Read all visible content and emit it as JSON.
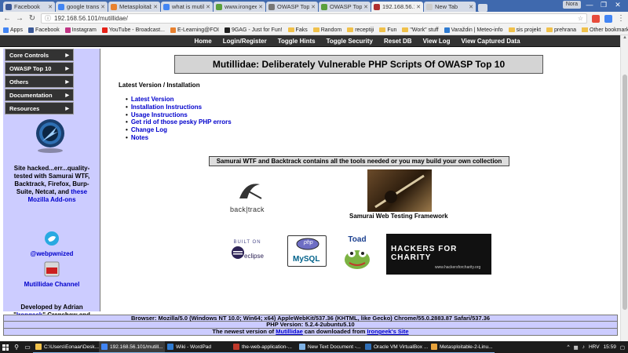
{
  "browser": {
    "tabs": [
      {
        "label": "Facebook",
        "color": "#3b5998"
      },
      {
        "label": "google translat",
        "color": "#4285f4"
      },
      {
        "label": "Metasploitable",
        "color": "#e8812f"
      },
      {
        "label": "what is mutilli",
        "color": "#4285f4"
      },
      {
        "label": "www.irongeek.c",
        "color": "#5aa03c"
      },
      {
        "label": "OWASP Top 10",
        "color": "#777777"
      },
      {
        "label": "OWASP Top 10",
        "color": "#5aa03c"
      },
      {
        "label": "192.168.56.101",
        "color": "#b03030"
      },
      {
        "label": "New Tab",
        "color": "#cccccc"
      }
    ],
    "user_chip": "Nora",
    "window_controls": [
      "—",
      "❐",
      "✕"
    ],
    "url": "192.168.56.101/mutillidae/",
    "bookmarks": [
      {
        "label": "Apps",
        "type": "apps"
      },
      {
        "label": "Facebook",
        "color": "#3b5998"
      },
      {
        "label": "Instagram",
        "color": "#c13584"
      },
      {
        "label": "YouTube - Broadcast...",
        "color": "#e62117"
      },
      {
        "label": "E-Learning@FOI",
        "color": "#e8812f"
      },
      {
        "label": "9GAG - Just for Fun!",
        "color": "#222222"
      },
      {
        "label": "Faks",
        "type": "folder"
      },
      {
        "label": "Random",
        "type": "folder"
      },
      {
        "label": "receptiji",
        "type": "folder"
      },
      {
        "label": "Fun",
        "type": "folder"
      },
      {
        "label": "\"Work\" stuff",
        "type": "folder"
      },
      {
        "label": "Varaždin | Meteo-info",
        "color": "#2f7bd1"
      },
      {
        "label": "sis projekt",
        "type": "folder"
      },
      {
        "label": "prehrana",
        "type": "folder"
      }
    ],
    "other_bookmarks": "Other bookmarks"
  },
  "topnav": [
    "Home",
    "Login/Register",
    "Toggle Hints",
    "Toggle Security",
    "Reset DB",
    "View Log",
    "View Captured Data"
  ],
  "sidebar": {
    "menu": [
      "Core Controls",
      "OWASP Top 10",
      "Others",
      "Documentation",
      "Resources"
    ],
    "hacked_text": "Site hacked...err...quality-tested with Samurai WTF, Backtrack, Firefox, Burp-Suite, Netcat, and",
    "hacked_link": "these Mozilla Add-ons",
    "twitter": "@webpwnized",
    "channel": "Mutillidae Channel",
    "dev_prefix": "Developed by Adrian \"",
    "dev_link": "Irongeek",
    "dev_suffix": "\" Crenshaw and Jeremy Druin"
  },
  "main": {
    "banner": "Mutillidae: Deliberately Vulnerable PHP Scripts Of OWASP Top 10",
    "section_title": "Latest Version / Installation",
    "links": [
      "Latest Version",
      "Installation Instructions",
      "Usage Instructions",
      "Get rid of those pesky PHP errors",
      "Change Log",
      "Notes"
    ],
    "samurai_box": "Samurai WTF and Backtrack contains all the tools needed or you may build your own collection",
    "backtrack": "back|track",
    "samurai_caption": "Samurai Web Testing Framework",
    "eclipse_top": "BUILT ON",
    "eclipse": "eclipse",
    "mysql": "MySQL",
    "php": "php",
    "toad": "Toad",
    "hfc": "HACKERS FOR CHARITY",
    "hfc_url": "www.hackersforcharity.org"
  },
  "footer": {
    "browser": "Browser: Mozilla/5.0 (Windows NT 10.0; Win64; x64) AppleWebKit/537.36 (KHTML, like Gecko) Chrome/55.0.2883.87 Safari/537.36",
    "php": "PHP Version: 5.2.4-2ubuntu5.10",
    "newest_prefix": "The newest version of ",
    "newest_link": "Mutillidae",
    "newest_mid": " can downloaded from ",
    "newest_link2": "Irongeek's Site"
  },
  "taskbar": {
    "items": [
      {
        "label": "C:\\Users\\Eonaar\\Desk...",
        "color": "#f0c14b"
      },
      {
        "label": "192.168.56.101/mutill...",
        "color": "#4285f4"
      },
      {
        "label": "Wiki - WordPad",
        "color": "#2f7bd1"
      },
      {
        "label": "the-web-application-...",
        "color": "#c0392b"
      },
      {
        "label": "New Text Document -...",
        "color": "#7fb2e5"
      },
      {
        "label": "Oracle VM VirtualBox ...",
        "color": "#2f6fb7"
      },
      {
        "label": "Metasploitable-2-Linu...",
        "color": "#e8a33c"
      }
    ],
    "lang": "HRV",
    "time": "15:59"
  }
}
